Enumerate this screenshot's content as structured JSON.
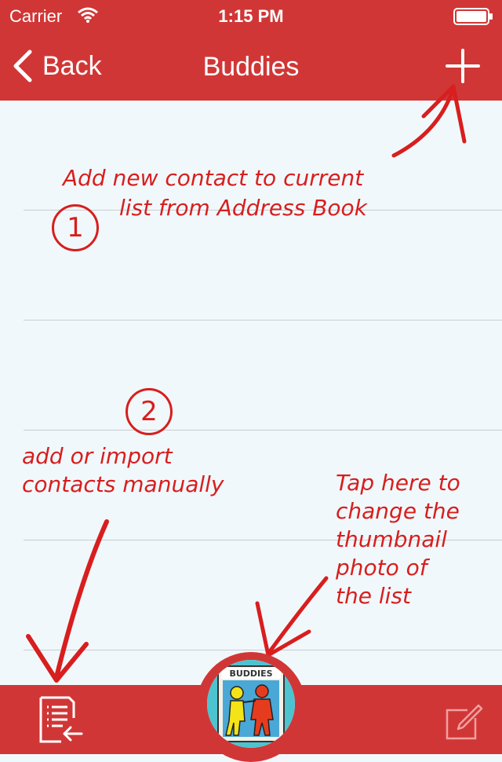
{
  "status_bar": {
    "carrier": "Carrier",
    "time": "1:15 PM",
    "wifi_icon": "wifi-icon",
    "battery_icon": "battery-icon"
  },
  "nav": {
    "back_label": "Back",
    "title": "Buddies",
    "add_icon": "plus-icon"
  },
  "annotations": {
    "step1_number": "1",
    "step1_text_line1": "Add new contact to current",
    "step1_text_line2": "list from Address Book",
    "step2_number": "2",
    "step2_text_line1": "add or import",
    "step2_text_line2": "contacts manually",
    "step3_text_line1": "Tap here to",
    "step3_text_line2": "change the",
    "step3_text_line3": "thumbnail",
    "step3_text_line4": "photo of",
    "step3_text_line5": "the list"
  },
  "toolbar": {
    "import_icon": "import-contacts-icon",
    "edit_icon": "compose-icon",
    "thumbnail_label": "BUDDIES"
  },
  "colors": {
    "bar_red": "#d13636",
    "annotation_red": "#d81e1e",
    "background": "#f1f8fb"
  }
}
